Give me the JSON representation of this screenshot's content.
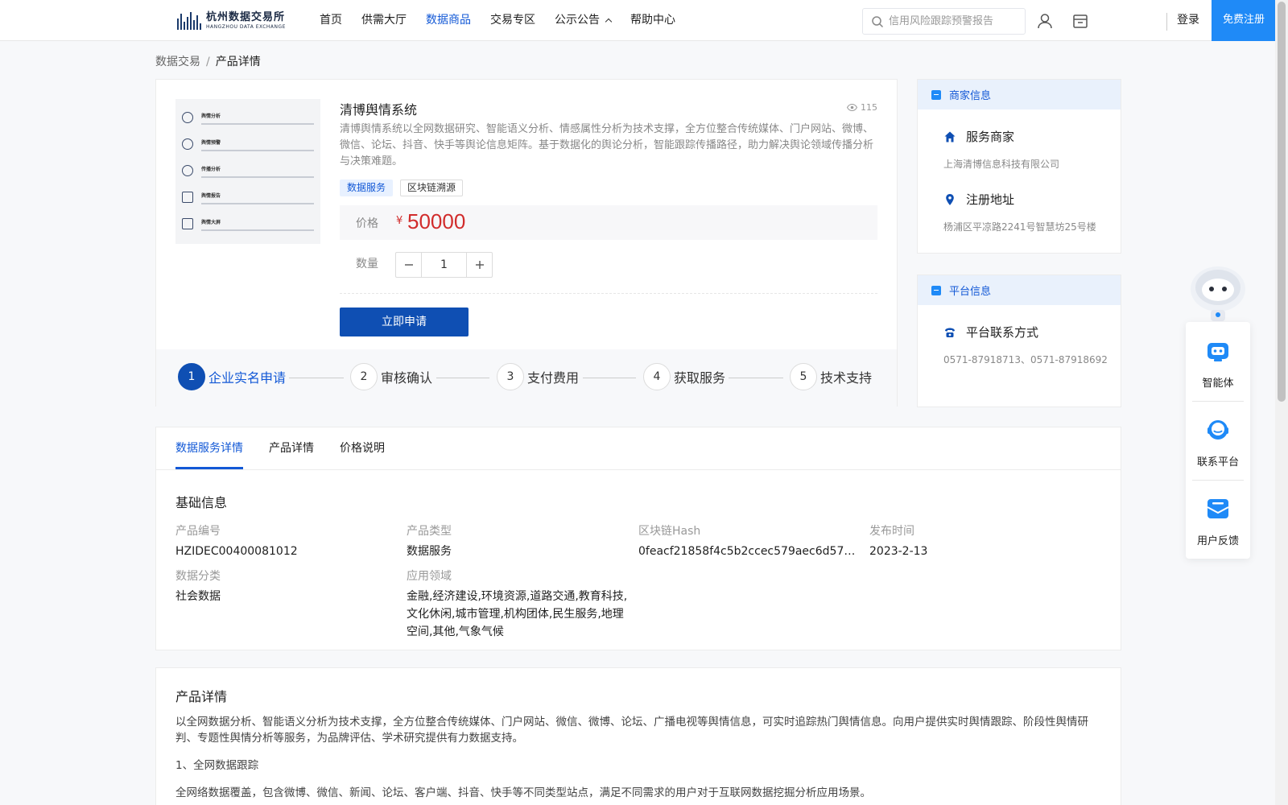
{
  "header": {
    "logo_cn": "杭州数据交易所",
    "logo_en": "HANGZHOU DATA EXCHANGE",
    "nav": [
      {
        "label": "首页"
      },
      {
        "label": "供需大厅"
      },
      {
        "label": "数据商品"
      },
      {
        "label": "交易专区"
      },
      {
        "label": "公示公告"
      },
      {
        "label": "帮助中心"
      }
    ],
    "active_nav": "数据商品",
    "search_placeholder": "信用风险跟踪预警报告",
    "login": "登录",
    "register": "免费注册"
  },
  "breadcrumb": {
    "root": "数据交易",
    "sep": "/",
    "current": "产品详情"
  },
  "product": {
    "title": "清博舆情系统",
    "views": "115",
    "description": "清博舆情系统以全网数据研究、智能语义分析、情感属性分析为技术支撑，全方位整合传统媒体、门户网站、微博、微信、论坛、抖音、快手等舆论信息矩阵。基于数据化的舆论分析，智能跟踪传播路径，助力解决舆论领域传播分析与决策难题。",
    "tags": [
      "数据服务",
      "区块链溯源"
    ],
    "price_label": "价格",
    "currency": "¥",
    "price": "50000",
    "qty_label": "数量",
    "qty": "1",
    "apply": "立即申请",
    "thumbnail": [
      "舆情分析",
      "舆情预警",
      "传播分析",
      "舆情报告",
      "舆情大屏"
    ]
  },
  "steps": [
    {
      "num": "1",
      "label": "企业实名申请"
    },
    {
      "num": "2",
      "label": "审核确认"
    },
    {
      "num": "3",
      "label": "支付费用"
    },
    {
      "num": "4",
      "label": "获取服务"
    },
    {
      "num": "5",
      "label": "技术支持"
    }
  ],
  "merchant": {
    "head": "商家信息",
    "service_label": "服务商家",
    "service_value": "上海清博信息科技有限公司",
    "address_label": "注册地址",
    "address_value": "杨浦区平凉路2241号智慧坊25号楼"
  },
  "platform": {
    "head": "平台信息",
    "contact_label": "平台联系方式",
    "contact_value": "0571-87918713、0571-87918692"
  },
  "float": {
    "agent": "智能体",
    "contact": "联系平台",
    "feedback": "用户反馈"
  },
  "tabs": [
    "数据服务详情",
    "产品详情",
    "价格说明"
  ],
  "basic": {
    "title": "基础信息",
    "fields": [
      {
        "k": "产品编号",
        "v": "HZIDEC00400081012"
      },
      {
        "k": "产品类型",
        "v": "数据服务"
      },
      {
        "k": "区块链Hash",
        "v": "0feacf21858f4c5b2ccec579aec6d574da1…"
      },
      {
        "k": "发布时间",
        "v": "2023-2-13"
      },
      {
        "k": "数据分类",
        "v": "社会数据"
      },
      {
        "k": "应用领域",
        "v": "金融,经济建设,环境资源,道路交通,教育科技,文化休闲,城市管理,机构团体,民生服务,地理空间,其他,气象气候"
      }
    ]
  },
  "detail": {
    "title": "产品详情",
    "p1": "以全网数据分析、智能语义分析为技术支撑，全方位整合传统媒体、门户网站、微信、微博、论坛、广播电视等舆情信息，可实时追踪热门舆情信息。向用户提供实时舆情跟踪、阶段性舆情研判、专题性舆情分析等服务，为品牌评估、学术研究提供有力数据支持。",
    "p2": "1、全网数据跟踪",
    "p3": "全网络数据覆盖，包含微博、微信、新闻、论坛、客户端、抖音、快手等不同类型站点，满足不同需求的用户对于互联网数据挖掘分析应用场景。"
  },
  "colors": {
    "primary": "#1258d6",
    "button": "#0f4fb3",
    "price": "#d12c2c",
    "register": "#1f8af7"
  }
}
